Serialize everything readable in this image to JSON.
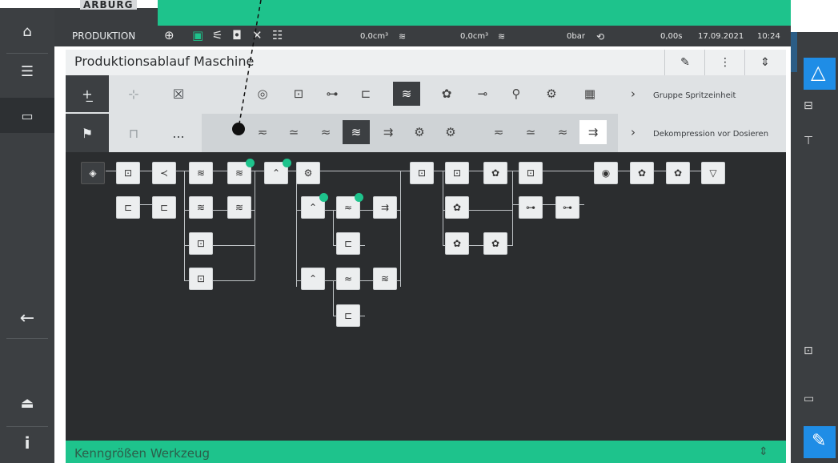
{
  "header": {
    "logo": "ARBURG",
    "mode": "PRODUKTION",
    "volume1": "0,0cm³",
    "volume2": "0,0cm³",
    "pressure": "0bar",
    "time_value": "0,00s",
    "date": "17.09.2021",
    "time": "10:24"
  },
  "panel": {
    "title": "Produktionsablauf Maschine",
    "group_label_1": "Gruppe Spritzeinheit",
    "group_label_2": "Dekompression vor Dosieren",
    "more_label": "..."
  },
  "bottom": {
    "title": "Kenngrößen Werkzeug"
  },
  "colors": {
    "accent_green": "#1ec38c",
    "accent_blue": "#1f8de6",
    "sidebar_dark": "#3c3f42",
    "panel_dark": "#2b2d2f"
  }
}
